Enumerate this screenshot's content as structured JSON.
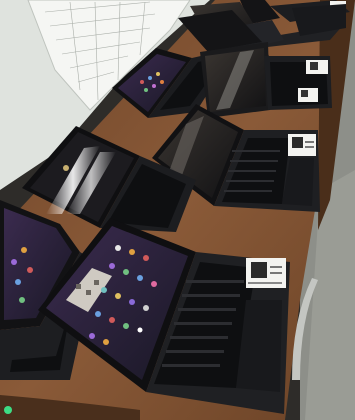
{
  "scene": {
    "type": "photo",
    "colors": {
      "wall": "#e7ebe6",
      "wall_shadow": "#c9cfc9",
      "table": "#7a4f30",
      "table_dark": "#5a3820",
      "floor": "#8c8e87",
      "laptop_body": "#1d1e21",
      "keyboard": "#0f1012",
      "key": "#2a2b2f",
      "screen_off": "#141416",
      "screen_glare": "#f2f2ef",
      "screen_ui": "#2b2340",
      "sticker": "#f4f4f2",
      "strap": "#b8b8b4"
    },
    "laptop_count": 8,
    "qr_sticker_count": 5
  }
}
